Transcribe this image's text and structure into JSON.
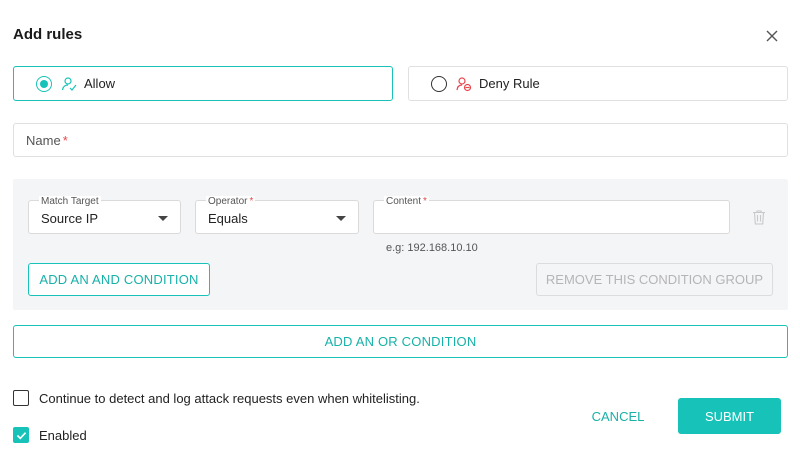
{
  "dialog": {
    "title": "Add rules"
  },
  "rule_type": {
    "allow_label": "Allow",
    "deny_label": "Deny Rule",
    "selected": "Allow"
  },
  "name_field": {
    "label": "Name",
    "required_mark": "*",
    "value": ""
  },
  "condition_group": {
    "match_target": {
      "label": "Match Target",
      "value": "Source IP"
    },
    "operator": {
      "label": "Operator",
      "required_mark": "*",
      "value": "Equals"
    },
    "content": {
      "label": "Content",
      "required_mark": "*",
      "value": "",
      "hint": "e.g: 192.168.10.10"
    },
    "add_and_label": "ADD AN AND CONDITION",
    "remove_group_label": "REMOVE THIS CONDITION GROUP"
  },
  "add_or_label": "ADD AN OR CONDITION",
  "options": {
    "continue_detect_label": "Continue to detect and log attack requests even when whitelisting.",
    "continue_detect_checked": false,
    "enabled_label": "Enabled",
    "enabled_checked": true
  },
  "footer": {
    "cancel_label": "CANCEL",
    "submit_label": "SUBMIT"
  },
  "colors": {
    "accent": "#17c3b9",
    "required": "#e5484d",
    "panel": "#f4f5f7"
  },
  "icons": [
    "close-icon",
    "user-check-icon",
    "user-block-icon",
    "trash-icon",
    "chevron-down-icon",
    "checkmark-icon"
  ]
}
